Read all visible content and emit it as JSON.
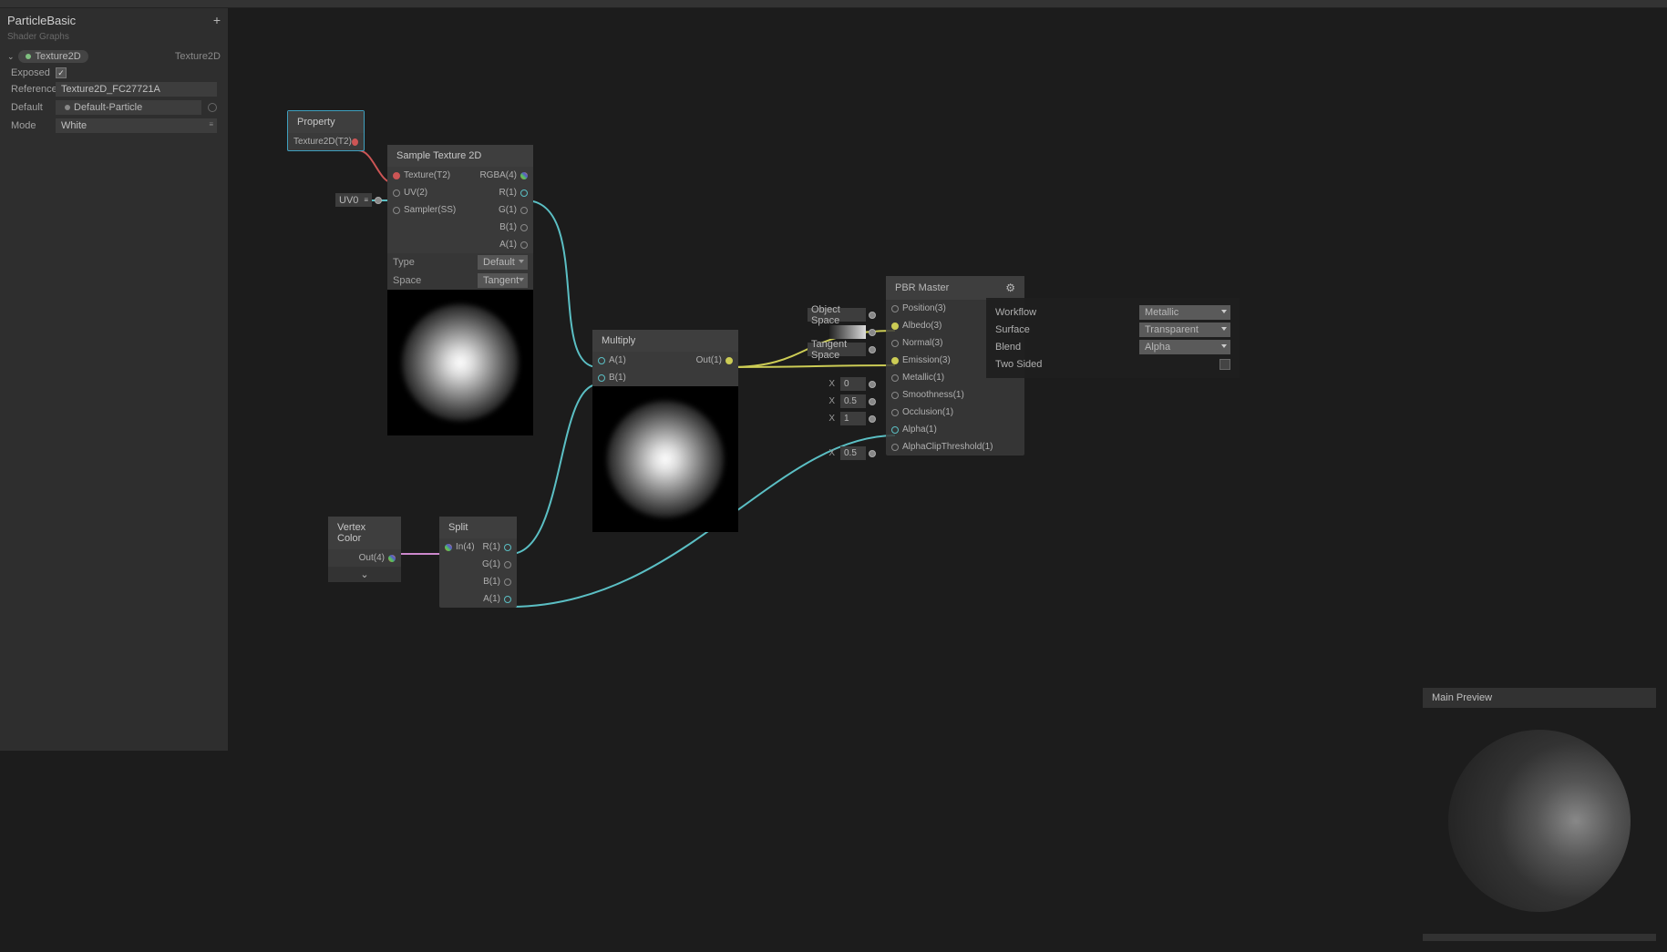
{
  "inspector": {
    "title": "ParticleBasic",
    "subtitle": "Shader Graphs",
    "plus": "+",
    "property": {
      "name": "Texture2D",
      "type": "Texture2D"
    },
    "exposed_label": "Exposed",
    "exposed_checked": "✓",
    "reference_label": "Reference",
    "reference_value": "Texture2D_FC27721A",
    "default_label": "Default",
    "default_value": "Default-Particle",
    "mode_label": "Mode",
    "mode_value": "White"
  },
  "nodes": {
    "property": {
      "title": "Property",
      "output": "Texture2D(T2)"
    },
    "sampleTex": {
      "title": "Sample Texture 2D",
      "inputs": {
        "texture": "Texture(T2)",
        "uv": "UV(2)",
        "sampler": "Sampler(SS)"
      },
      "uvDefault": "UV0",
      "outputs": {
        "rgba": "RGBA(4)",
        "r": "R(1)",
        "g": "G(1)",
        "b": "B(1)",
        "a": "A(1)"
      },
      "params": {
        "type_label": "Type",
        "type_value": "Default",
        "space_label": "Space",
        "space_value": "Tangent"
      }
    },
    "vertexColor": {
      "title": "Vertex Color",
      "output": "Out(4)",
      "chevron": "⌄"
    },
    "split": {
      "title": "Split",
      "input": "In(4)",
      "outputs": {
        "r": "R(1)",
        "g": "G(1)",
        "b": "B(1)",
        "a": "A(1)"
      }
    },
    "multiply": {
      "title": "Multiply",
      "inputs": {
        "a": "A(1)",
        "b": "B(1)"
      },
      "output": "Out(1)"
    },
    "pbr": {
      "title": "PBR Master",
      "leftExternal": {
        "objectSpace": "Object Space",
        "tangentSpace": "Tangent Space",
        "x": "X",
        "metallicVal": "0",
        "smoothnessVal": "0.5",
        "occlusionVal": "1",
        "alphaClipVal": "0.5"
      },
      "ports": {
        "position": "Position(3)",
        "albedo": "Albedo(3)",
        "normal": "Normal(3)",
        "emission": "Emission(3)",
        "metallic": "Metallic(1)",
        "smoothness": "Smoothness(1)",
        "occlusion": "Occlusion(1)",
        "alpha": "Alpha(1)",
        "alphaClip": "AlphaClipThreshold(1)"
      }
    }
  },
  "settings": {
    "workflow_label": "Workflow",
    "workflow_value": "Metallic",
    "surface_label": "Surface",
    "surface_value": "Transparent",
    "blend_label": "Blend",
    "blend_value": "Alpha",
    "twoSided_label": "Two Sided"
  },
  "mainPreview": {
    "title": "Main Preview"
  }
}
